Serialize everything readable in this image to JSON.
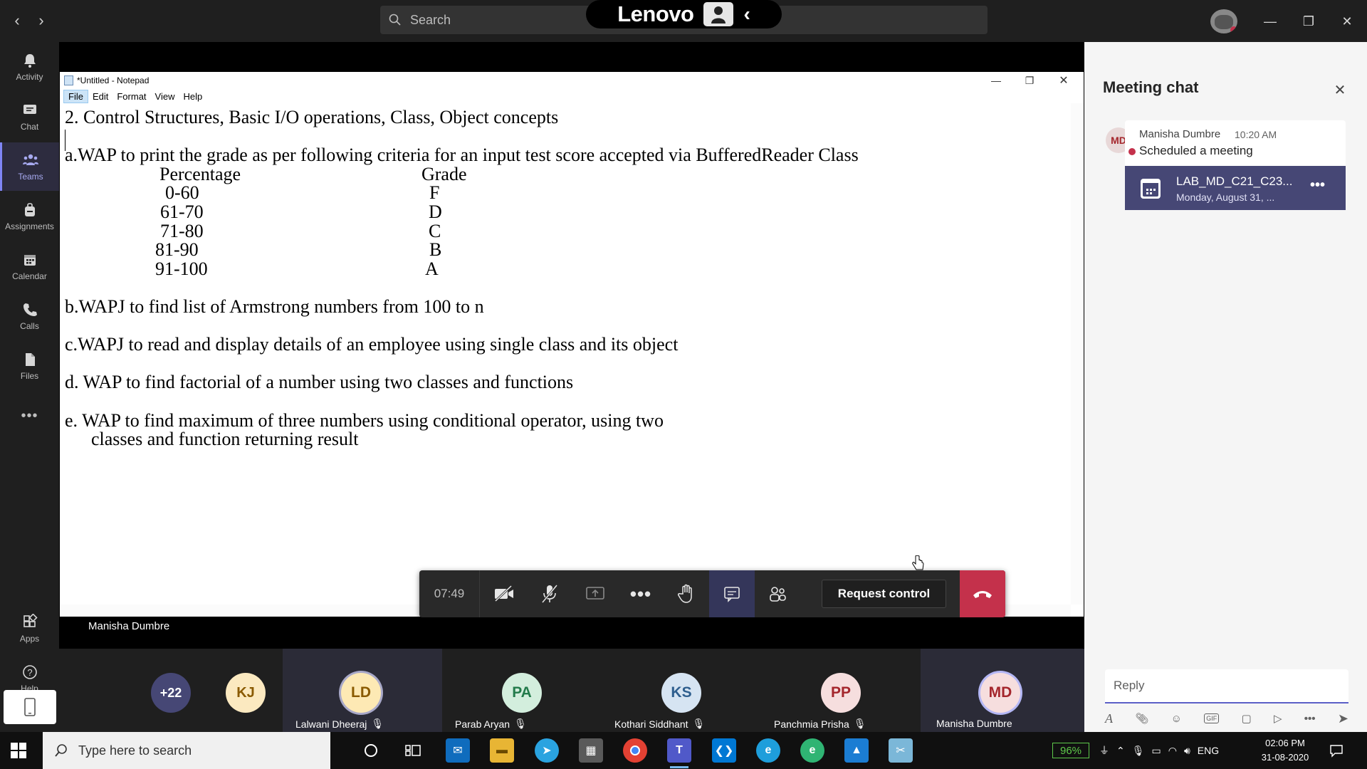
{
  "titlebar": {
    "search_placeholder": "Search",
    "lenovo_brand": "Lenovo"
  },
  "appbar": {
    "items": [
      {
        "label": "Activity",
        "icon": "bell-icon"
      },
      {
        "label": "Chat",
        "icon": "chat-icon"
      },
      {
        "label": "Teams",
        "icon": "teams-icon"
      },
      {
        "label": "Assignments",
        "icon": "backpack-icon"
      },
      {
        "label": "Calendar",
        "icon": "calendar-icon"
      },
      {
        "label": "Calls",
        "icon": "phone-icon"
      },
      {
        "label": "Files",
        "icon": "file-icon"
      }
    ],
    "more": "•••",
    "apps_label": "Apps",
    "help_label": "Help"
  },
  "notepad": {
    "title": "*Untitled - Notepad",
    "menu": [
      "File",
      "Edit",
      "Format",
      "View",
      "Help"
    ],
    "lines": {
      "heading": "2. Control Structures, Basic I/O operations, Class, Object concepts",
      "a": "a.WAP to print the grade as per following criteria for an input test score accepted via BufferedReader Class",
      "col_percentage": "Percentage",
      "col_grade": "Grade",
      "b": "b.WAPJ to find list of Armstrong numbers from 100 to n",
      "c": "c.WAPJ to read and display details of an employee using single class and its object",
      "d": "d. WAP to find factorial of a number using two classes and functions",
      "e1": "e. WAP to find maximum of three numbers using conditional operator, using two",
      "e2": "classes and function returning result"
    },
    "grades": [
      {
        "range": "0-60",
        "grade": "F"
      },
      {
        "range": "61-70",
        "grade": "D"
      },
      {
        "range": "71-80",
        "grade": "C"
      },
      {
        "range": "81-90",
        "grade": "B"
      },
      {
        "range": "91-100",
        "grade": "A"
      }
    ]
  },
  "controls": {
    "timer": "07:49",
    "request_control": "Request control"
  },
  "presenter": "Manisha Dumbre",
  "participants": {
    "overflow": "+22",
    "kj": "KJ",
    "people": [
      {
        "initials": "LD",
        "name": "Lalwani Dheeraj"
      },
      {
        "initials": "PA",
        "name": "Parab Aryan"
      },
      {
        "initials": "KS",
        "name": "Kothari Siddhant"
      },
      {
        "initials": "PP",
        "name": "Panchmia Prisha"
      },
      {
        "initials": "MD",
        "name": "Manisha Dumbre"
      }
    ]
  },
  "chat": {
    "title": "Meeting chat",
    "message": {
      "avatar": "MD",
      "sender": "Manisha Dumbre",
      "time": "10:20 AM",
      "text": "Scheduled a meeting",
      "card_title": "LAB_MD_C21_C23...",
      "card_date": "Monday, August 31, ..."
    },
    "reply_placeholder": "Reply"
  },
  "taskbar": {
    "search_placeholder": "Type here to search",
    "battery": "96%",
    "language": "ENG",
    "time": "02:06 PM",
    "date": "31-08-2020"
  },
  "colors": {
    "accent": "#5b5fc7",
    "hangup": "#c4314b",
    "appbar_active": "#7f85f5"
  }
}
